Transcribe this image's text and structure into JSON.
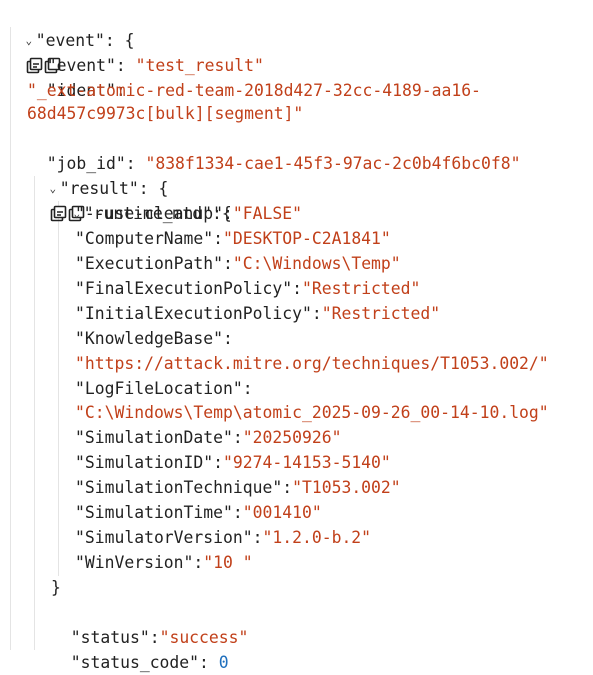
{
  "root": {
    "key": "\"event\"",
    "children": {
      "event": {
        "key": "\"event\"",
        "value": "\"test_result\""
      },
      "ident": {
        "key": "\"ident\"",
        "value_line1": "\"_ext-atomic-red-team-2018d427-32cc-4189-aa16-",
        "value_line2": "68d457c9973c[bulk][segment]\""
      },
      "job_id": {
        "key": "\"job_id\"",
        "value": "\"838f1334-cae1-45f3-97ac-2c0b4f6bc0f8\""
      },
      "result": {
        "key": "\"result\"",
        "runtime_mtd": {
          "key": "\"runtime_mtd\"",
          "entries": [
            {
              "key": "\"--use-cleanup\"",
              "value": "\"FALSE\""
            },
            {
              "key": "\"ComputerName\"",
              "value": "\"DESKTOP-C2A1841\""
            },
            {
              "key": "\"ExecutionPath\"",
              "value": "\"C:\\Windows\\Temp\""
            },
            {
              "key": "\"FinalExecutionPolicy\"",
              "value": "\"Restricted\""
            },
            {
              "key": "\"InitialExecutionPolicy\"",
              "value": "\"Restricted\""
            },
            {
              "key": "\"KnowledgeBase\"",
              "value": "\"https://attack.mitre.org/techniques/T1053.002/\""
            },
            {
              "key": "\"LogFileLocation\"",
              "value": "\"C:\\Windows\\Temp\\atomic_2025-09-26_00-14-10.log\""
            },
            {
              "key": "\"SimulationDate\"",
              "value": "\"20250926\""
            },
            {
              "key": "\"SimulationID\"",
              "value": "\"9274-14153-5140\""
            },
            {
              "key": "\"SimulationTechnique\"",
              "value": "\"T1053.002\""
            },
            {
              "key": "\"SimulationTime\"",
              "value": "\"001410\""
            },
            {
              "key": "\"SimulatorVersion\"",
              "value": "\"1.2.0-b.2\""
            },
            {
              "key": "\"WinVersion\"",
              "value": "\"10 \""
            }
          ]
        },
        "status": {
          "key": "\"status\"",
          "value": "\"success\""
        },
        "status_code": {
          "key": "\"status_code\"",
          "value": "0"
        }
      }
    }
  },
  "icons": {
    "expand": "expand-all-icon",
    "copy": "copy-icon",
    "toggle": "chevron-down-icon"
  },
  "colors": {
    "key": "#222222",
    "string": "#c1401a",
    "number": "#1f6fbd"
  },
  "punct": {
    "colon": ":",
    "open": "{",
    "close": "}"
  }
}
